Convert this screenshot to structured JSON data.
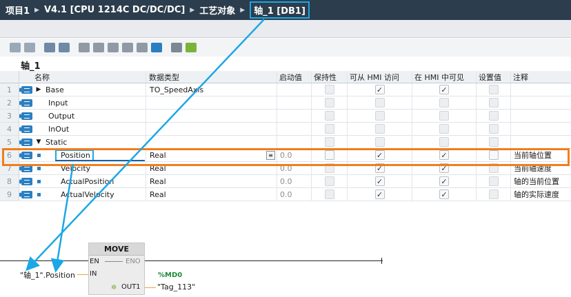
{
  "breadcrumb": {
    "items": [
      "项目1",
      "V4.1 [CPU 1214C DC/DC/DC]",
      "工艺对象",
      "轴_1 [DB1]"
    ],
    "separator": "▶"
  },
  "db_name": "轴_1",
  "columns": {
    "name": "名称",
    "datatype": "数据类型",
    "start": "启动值",
    "retain": "保持性",
    "hmi_access": "可从 HMI 访问",
    "hmi_visible": "在 HMI 中可见",
    "setpoint": "设置值",
    "comment": "注释"
  },
  "rows": [
    {
      "num": "1",
      "name": "Base",
      "type": "TO_SpeedAxis",
      "start": "",
      "comment": ""
    },
    {
      "num": "2",
      "name": "Input",
      "type": "",
      "start": "",
      "comment": ""
    },
    {
      "num": "3",
      "name": "Output",
      "type": "",
      "start": "",
      "comment": ""
    },
    {
      "num": "4",
      "name": "InOut",
      "type": "",
      "start": "",
      "comment": ""
    },
    {
      "num": "5",
      "name": "Static",
      "type": "",
      "start": "",
      "comment": ""
    },
    {
      "num": "6",
      "name": "Position",
      "type": "Real",
      "start": "0.0",
      "comment": "当前轴位置"
    },
    {
      "num": "7",
      "name": "Velocity",
      "type": "Real",
      "start": "0.0",
      "comment": "当前轴速度"
    },
    {
      "num": "8",
      "name": "ActualPosition",
      "type": "Real",
      "start": "0.0",
      "comment": "轴的当前位置"
    },
    {
      "num": "9",
      "name": "ActualVelocity",
      "type": "Real",
      "start": "0.0",
      "comment": "轴的实际速度"
    }
  ],
  "icons": {
    "tree_collapsed": "▶",
    "tree_expanded": "▼",
    "check": "✓",
    "picker": "≡",
    "out_marker": "✲"
  },
  "ladder": {
    "block_title": "MOVE",
    "pin_en": "EN",
    "pin_eno": "ENO",
    "pin_in": "IN",
    "pin_out": "OUT1",
    "in_param": "\"轴_1\".Position",
    "out_address": "%MD0",
    "out_tag": "\"Tag_113\""
  },
  "colors": {
    "title_bar": "#2c3d4d",
    "callout_blue": "#1aa7e6",
    "highlight_orange": "#f07d1e",
    "interface_icon": "#2a7fc1"
  }
}
